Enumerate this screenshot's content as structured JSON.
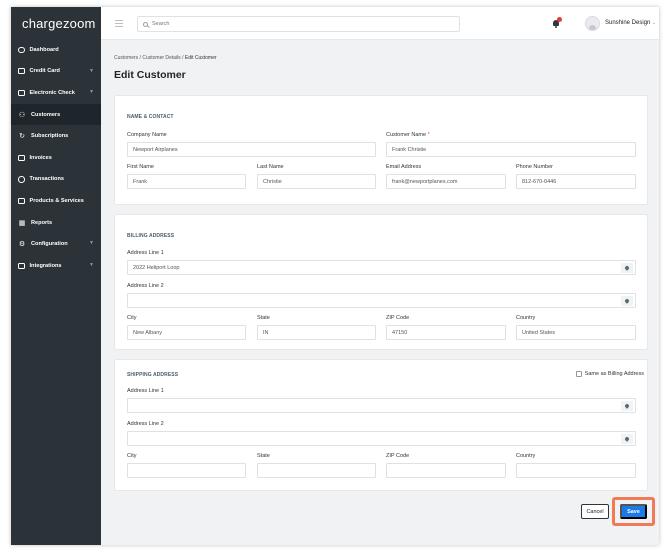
{
  "app": {
    "logo": "chargezoom"
  },
  "sidebar": {
    "items": [
      {
        "label": "Dashboard",
        "icon": "home-icon",
        "chevron": false
      },
      {
        "label": "Credit Card",
        "icon": "credit-card-icon",
        "chevron": true
      },
      {
        "label": "Electronic Check",
        "icon": "bank-icon",
        "chevron": true
      },
      {
        "label": "Customers",
        "icon": "users-icon",
        "chevron": false
      },
      {
        "label": "Subscriptions",
        "icon": "refresh-icon",
        "chevron": false
      },
      {
        "label": "Invoices",
        "icon": "invoice-icon",
        "chevron": false
      },
      {
        "label": "Transactions",
        "icon": "dollar-circle-icon",
        "chevron": false
      },
      {
        "label": "Products & Services",
        "icon": "box-icon",
        "chevron": false
      },
      {
        "label": "Reports",
        "icon": "bar-chart-icon",
        "chevron": false
      },
      {
        "label": "Configuration",
        "icon": "gear-icon",
        "chevron": true
      },
      {
        "label": "Integrations",
        "icon": "plug-icon",
        "chevron": true
      }
    ]
  },
  "topbar": {
    "search_placeholder": "Search",
    "user_name": "Sunshine Design"
  },
  "breadcrumb": {
    "path": "Customers / Customer Details / ",
    "current": "Edit Customer"
  },
  "page_title": "Edit Customer",
  "name_contact": {
    "title": "NAME & CONTACT",
    "company_label": "Company Name",
    "company_value": "Newport Airplanes",
    "customer_label": "Customer Name",
    "customer_required": "*",
    "customer_value": "Frank Christie",
    "first_label": "First Name",
    "first_value": "Frank",
    "last_label": "Last Name",
    "last_value": "Christie",
    "email_label": "Email Address",
    "email_value": "frank@newportplanes.com",
    "phone_label": "Phone Number",
    "phone_value": "812-670-0446"
  },
  "billing": {
    "title": "BILLING ADDRESS",
    "addr1_label": "Address Line 1",
    "addr1_value": "2022 Heliport Loop",
    "addr2_label": "Address Line 2",
    "addr2_value": "",
    "city_label": "City",
    "city_value": "New Albany",
    "state_label": "State",
    "state_value": "IN",
    "zip_label": "ZIP Code",
    "zip_value": "47150",
    "country_label": "Country",
    "country_value": "United States"
  },
  "shipping": {
    "title": "SHIPPING ADDRESS",
    "same_label": "Same as Billing Address",
    "addr1_label": "Address Line 1",
    "addr1_value": "",
    "addr2_label": "Address Line 2",
    "addr2_value": "",
    "city_label": "City",
    "city_value": "",
    "state_label": "State",
    "state_value": "",
    "zip_label": "ZIP Code",
    "zip_value": "",
    "country_label": "Country",
    "country_value": ""
  },
  "actions": {
    "cancel_label": "Cancel",
    "save_label": "Save"
  },
  "colors": {
    "sidebar": "#2b3339",
    "accent": "#1a7be6",
    "highlight": "#f07a57",
    "notification": "#e03a3a"
  }
}
